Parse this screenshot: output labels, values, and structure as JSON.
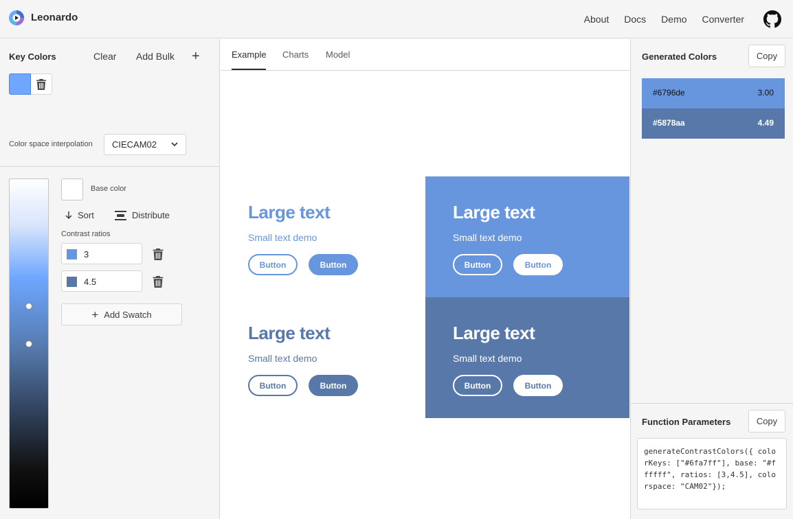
{
  "header": {
    "brand": "Leonardo",
    "nav": [
      "About",
      "Docs",
      "Demo",
      "Converter"
    ]
  },
  "key_colors": {
    "title": "Key Colors",
    "clear_label": "Clear",
    "add_bulk_label": "Add Bulk",
    "key_color": "#6fa7ff",
    "interpolation_label": "Color space interpolation",
    "interpolation_value": "CIECAM02"
  },
  "swatches": {
    "base_color_label": "Base color",
    "base_color": "#ffffff",
    "sort_label": "Sort",
    "distribute_label": "Distribute",
    "contrast_label": "Contrast ratios",
    "ratios": [
      {
        "value": "3",
        "color": "#6796de"
      },
      {
        "value": "4.5",
        "color": "#5878aa"
      }
    ],
    "add_swatch_label": "Add Swatch"
  },
  "tabs": [
    "Example",
    "Charts",
    "Model"
  ],
  "demo": {
    "large_text": "Large text",
    "small_text": "Small text demo",
    "button_label": "Button"
  },
  "generated": {
    "title": "Generated Colors",
    "copy_label": "Copy",
    "colors": [
      {
        "hex": "#6796de",
        "ratio": "3.00"
      },
      {
        "hex": "#5878aa",
        "ratio": "4.49"
      }
    ]
  },
  "function_params": {
    "title": "Function Parameters",
    "copy_label": "Copy",
    "code": "generateContrastColors({ colorKeys: [\"#6fa7ff\"], base: \"#ffffff\", ratios: [3,4.5], colorspace: \"CAM02\"});"
  }
}
